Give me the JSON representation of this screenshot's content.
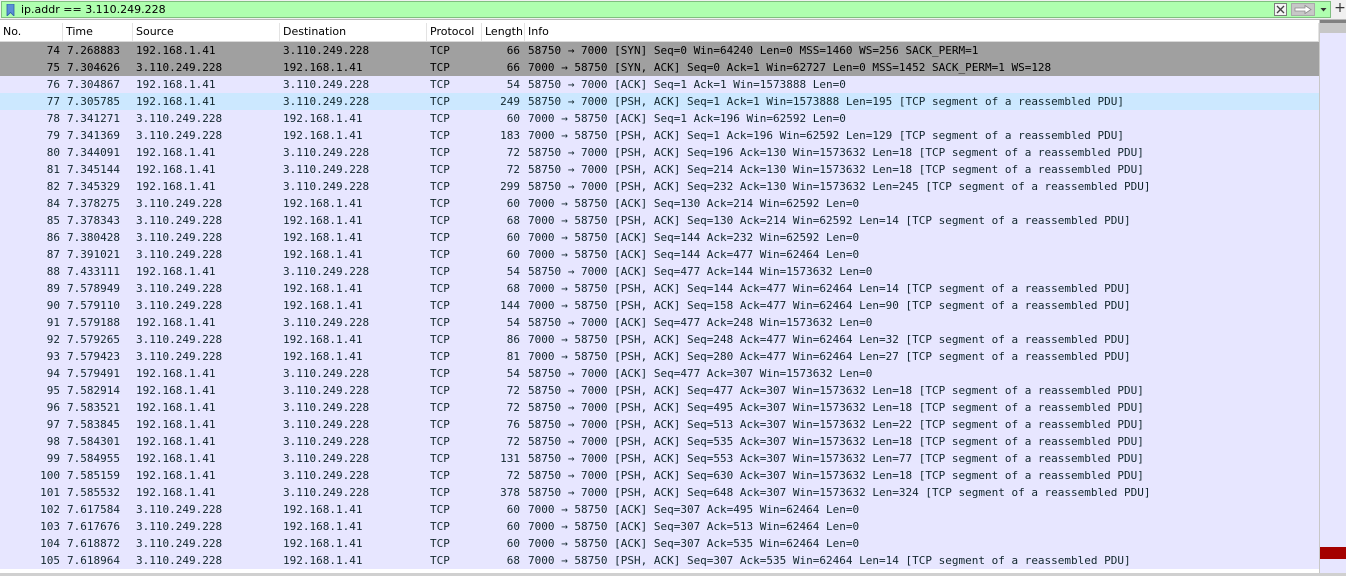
{
  "filter": {
    "value": "ip.addr == 3.110.249.228",
    "icons": [
      "bookmark-icon",
      "clear-icon",
      "apply-arrow-icon",
      "chevron-down-icon",
      "plus-icon"
    ],
    "add_label": "+"
  },
  "columns": [
    "No.",
    "Time",
    "Source",
    "Destination",
    "Protocol",
    "Length",
    "Info"
  ],
  "colors": {
    "row": "#e7e6ff",
    "syn_row": "#a0a0a0",
    "selected_row": "#cce8ff",
    "filter_ok": "#afffaf",
    "marker": "#a40000"
  },
  "packets": [
    {
      "no": "74",
      "time": "7.268883",
      "src": "192.168.1.41",
      "dst": "3.110.249.228",
      "proto": "TCP",
      "len": "66",
      "info": "58750 → 7000 [SYN] Seq=0 Win=64240 Len=0 MSS=1460 WS=256 SACK_PERM=1",
      "style": "syn"
    },
    {
      "no": "75",
      "time": "7.304626",
      "src": "3.110.249.228",
      "dst": "192.168.1.41",
      "proto": "TCP",
      "len": "66",
      "info": "7000 → 58750 [SYN, ACK] Seq=0 Ack=1 Win=62727 Len=0 MSS=1452 SACK_PERM=1 WS=128",
      "style": "syn"
    },
    {
      "no": "76",
      "time": "7.304867",
      "src": "192.168.1.41",
      "dst": "3.110.249.228",
      "proto": "TCP",
      "len": "54",
      "info": "58750 → 7000 [ACK] Seq=1 Ack=1 Win=1573888 Len=0",
      "style": ""
    },
    {
      "no": "77",
      "time": "7.305785",
      "src": "192.168.1.41",
      "dst": "3.110.249.228",
      "proto": "TCP",
      "len": "249",
      "info": "58750 → 7000 [PSH, ACK] Seq=1 Ack=1 Win=1573888 Len=195 [TCP segment of a reassembled PDU]",
      "style": "selected"
    },
    {
      "no": "78",
      "time": "7.341271",
      "src": "3.110.249.228",
      "dst": "192.168.1.41",
      "proto": "TCP",
      "len": "60",
      "info": "7000 → 58750 [ACK] Seq=1 Ack=196 Win=62592 Len=0",
      "style": ""
    },
    {
      "no": "79",
      "time": "7.341369",
      "src": "3.110.249.228",
      "dst": "192.168.1.41",
      "proto": "TCP",
      "len": "183",
      "info": "7000 → 58750 [PSH, ACK] Seq=1 Ack=196 Win=62592 Len=129 [TCP segment of a reassembled PDU]",
      "style": ""
    },
    {
      "no": "80",
      "time": "7.344091",
      "src": "192.168.1.41",
      "dst": "3.110.249.228",
      "proto": "TCP",
      "len": "72",
      "info": "58750 → 7000 [PSH, ACK] Seq=196 Ack=130 Win=1573632 Len=18 [TCP segment of a reassembled PDU]",
      "style": ""
    },
    {
      "no": "81",
      "time": "7.345144",
      "src": "192.168.1.41",
      "dst": "3.110.249.228",
      "proto": "TCP",
      "len": "72",
      "info": "58750 → 7000 [PSH, ACK] Seq=214 Ack=130 Win=1573632 Len=18 [TCP segment of a reassembled PDU]",
      "style": ""
    },
    {
      "no": "82",
      "time": "7.345329",
      "src": "192.168.1.41",
      "dst": "3.110.249.228",
      "proto": "TCP",
      "len": "299",
      "info": "58750 → 7000 [PSH, ACK] Seq=232 Ack=130 Win=1573632 Len=245 [TCP segment of a reassembled PDU]",
      "style": ""
    },
    {
      "no": "84",
      "time": "7.378275",
      "src": "3.110.249.228",
      "dst": "192.168.1.41",
      "proto": "TCP",
      "len": "60",
      "info": "7000 → 58750 [ACK] Seq=130 Ack=214 Win=62592 Len=0",
      "style": ""
    },
    {
      "no": "85",
      "time": "7.378343",
      "src": "3.110.249.228",
      "dst": "192.168.1.41",
      "proto": "TCP",
      "len": "68",
      "info": "7000 → 58750 [PSH, ACK] Seq=130 Ack=214 Win=62592 Len=14 [TCP segment of a reassembled PDU]",
      "style": ""
    },
    {
      "no": "86",
      "time": "7.380428",
      "src": "3.110.249.228",
      "dst": "192.168.1.41",
      "proto": "TCP",
      "len": "60",
      "info": "7000 → 58750 [ACK] Seq=144 Ack=232 Win=62592 Len=0",
      "style": ""
    },
    {
      "no": "87",
      "time": "7.391021",
      "src": "3.110.249.228",
      "dst": "192.168.1.41",
      "proto": "TCP",
      "len": "60",
      "info": "7000 → 58750 [ACK] Seq=144 Ack=477 Win=62464 Len=0",
      "style": ""
    },
    {
      "no": "88",
      "time": "7.433111",
      "src": "192.168.1.41",
      "dst": "3.110.249.228",
      "proto": "TCP",
      "len": "54",
      "info": "58750 → 7000 [ACK] Seq=477 Ack=144 Win=1573632 Len=0",
      "style": ""
    },
    {
      "no": "89",
      "time": "7.578949",
      "src": "3.110.249.228",
      "dst": "192.168.1.41",
      "proto": "TCP",
      "len": "68",
      "info": "7000 → 58750 [PSH, ACK] Seq=144 Ack=477 Win=62464 Len=14 [TCP segment of a reassembled PDU]",
      "style": ""
    },
    {
      "no": "90",
      "time": "7.579110",
      "src": "3.110.249.228",
      "dst": "192.168.1.41",
      "proto": "TCP",
      "len": "144",
      "info": "7000 → 58750 [PSH, ACK] Seq=158 Ack=477 Win=62464 Len=90 [TCP segment of a reassembled PDU]",
      "style": ""
    },
    {
      "no": "91",
      "time": "7.579188",
      "src": "192.168.1.41",
      "dst": "3.110.249.228",
      "proto": "TCP",
      "len": "54",
      "info": "58750 → 7000 [ACK] Seq=477 Ack=248 Win=1573632 Len=0",
      "style": ""
    },
    {
      "no": "92",
      "time": "7.579265",
      "src": "3.110.249.228",
      "dst": "192.168.1.41",
      "proto": "TCP",
      "len": "86",
      "info": "7000 → 58750 [PSH, ACK] Seq=248 Ack=477 Win=62464 Len=32 [TCP segment of a reassembled PDU]",
      "style": ""
    },
    {
      "no": "93",
      "time": "7.579423",
      "src": "3.110.249.228",
      "dst": "192.168.1.41",
      "proto": "TCP",
      "len": "81",
      "info": "7000 → 58750 [PSH, ACK] Seq=280 Ack=477 Win=62464 Len=27 [TCP segment of a reassembled PDU]",
      "style": ""
    },
    {
      "no": "94",
      "time": "7.579491",
      "src": "192.168.1.41",
      "dst": "3.110.249.228",
      "proto": "TCP",
      "len": "54",
      "info": "58750 → 7000 [ACK] Seq=477 Ack=307 Win=1573632 Len=0",
      "style": ""
    },
    {
      "no": "95",
      "time": "7.582914",
      "src": "192.168.1.41",
      "dst": "3.110.249.228",
      "proto": "TCP",
      "len": "72",
      "info": "58750 → 7000 [PSH, ACK] Seq=477 Ack=307 Win=1573632 Len=18 [TCP segment of a reassembled PDU]",
      "style": ""
    },
    {
      "no": "96",
      "time": "7.583521",
      "src": "192.168.1.41",
      "dst": "3.110.249.228",
      "proto": "TCP",
      "len": "72",
      "info": "58750 → 7000 [PSH, ACK] Seq=495 Ack=307 Win=1573632 Len=18 [TCP segment of a reassembled PDU]",
      "style": ""
    },
    {
      "no": "97",
      "time": "7.583845",
      "src": "192.168.1.41",
      "dst": "3.110.249.228",
      "proto": "TCP",
      "len": "76",
      "info": "58750 → 7000 [PSH, ACK] Seq=513 Ack=307 Win=1573632 Len=22 [TCP segment of a reassembled PDU]",
      "style": ""
    },
    {
      "no": "98",
      "time": "7.584301",
      "src": "192.168.1.41",
      "dst": "3.110.249.228",
      "proto": "TCP",
      "len": "72",
      "info": "58750 → 7000 [PSH, ACK] Seq=535 Ack=307 Win=1573632 Len=18 [TCP segment of a reassembled PDU]",
      "style": ""
    },
    {
      "no": "99",
      "time": "7.584955",
      "src": "192.168.1.41",
      "dst": "3.110.249.228",
      "proto": "TCP",
      "len": "131",
      "info": "58750 → 7000 [PSH, ACK] Seq=553 Ack=307 Win=1573632 Len=77 [TCP segment of a reassembled PDU]",
      "style": ""
    },
    {
      "no": "100",
      "time": "7.585159",
      "src": "192.168.1.41",
      "dst": "3.110.249.228",
      "proto": "TCP",
      "len": "72",
      "info": "58750 → 7000 [PSH, ACK] Seq=630 Ack=307 Win=1573632 Len=18 [TCP segment of a reassembled PDU]",
      "style": ""
    },
    {
      "no": "101",
      "time": "7.585532",
      "src": "192.168.1.41",
      "dst": "3.110.249.228",
      "proto": "TCP",
      "len": "378",
      "info": "58750 → 7000 [PSH, ACK] Seq=648 Ack=307 Win=1573632 Len=324 [TCP segment of a reassembled PDU]",
      "style": ""
    },
    {
      "no": "102",
      "time": "7.617584",
      "src": "3.110.249.228",
      "dst": "192.168.1.41",
      "proto": "TCP",
      "len": "60",
      "info": "7000 → 58750 [ACK] Seq=307 Ack=495 Win=62464 Len=0",
      "style": ""
    },
    {
      "no": "103",
      "time": "7.617676",
      "src": "3.110.249.228",
      "dst": "192.168.1.41",
      "proto": "TCP",
      "len": "60",
      "info": "7000 → 58750 [ACK] Seq=307 Ack=513 Win=62464 Len=0",
      "style": ""
    },
    {
      "no": "104",
      "time": "7.618872",
      "src": "3.110.249.228",
      "dst": "192.168.1.41",
      "proto": "TCP",
      "len": "60",
      "info": "7000 → 58750 [ACK] Seq=307 Ack=535 Win=62464 Len=0",
      "style": ""
    },
    {
      "no": "105",
      "time": "7.618964",
      "src": "3.110.249.228",
      "dst": "192.168.1.41",
      "proto": "TCP",
      "len": "68",
      "info": "7000 → 58750 [PSH, ACK] Seq=307 Ack=535 Win=62464 Len=14 [TCP segment of a reassembled PDU]",
      "style": ""
    }
  ]
}
